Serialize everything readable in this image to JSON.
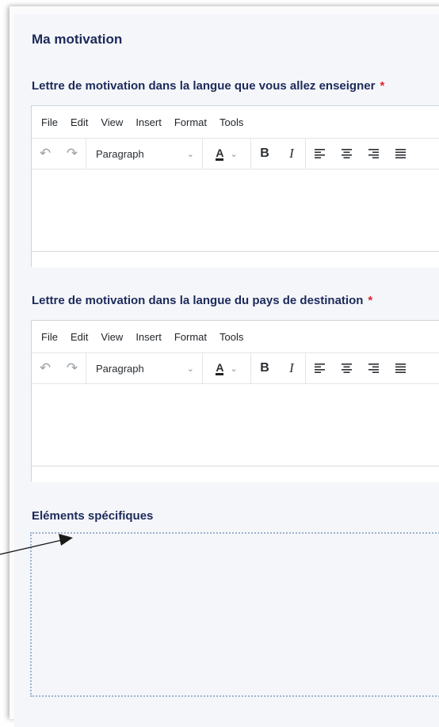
{
  "section": {
    "title": "Ma motivation"
  },
  "editor_menu": [
    "File",
    "Edit",
    "View",
    "Insert",
    "Format",
    "Tools"
  ],
  "editor_toolbar": {
    "block_format": "Paragraph",
    "text_color_glyph": "A",
    "bold_glyph": "B",
    "italic_glyph": "I"
  },
  "fields": [
    {
      "label": "Lettre de motivation dans la langue que vous allez enseigner",
      "required_mark": "*"
    },
    {
      "label": "Lettre de motivation dans la langue du pays de destination",
      "required_mark": "*"
    },
    {
      "label": "Eléments spécifiques"
    }
  ],
  "icons": {
    "undo": "undo-icon",
    "redo": "redo-icon",
    "align_left": "align-left-icon",
    "align_center": "align-center-icon",
    "align_right": "align-right-icon",
    "align_justify": "align-justify-icon",
    "annotation": "arrow-icon"
  },
  "colors": {
    "heading": "#1c2a5a",
    "required": "#d9262e",
    "dropzone_border": "#9db3c9"
  }
}
